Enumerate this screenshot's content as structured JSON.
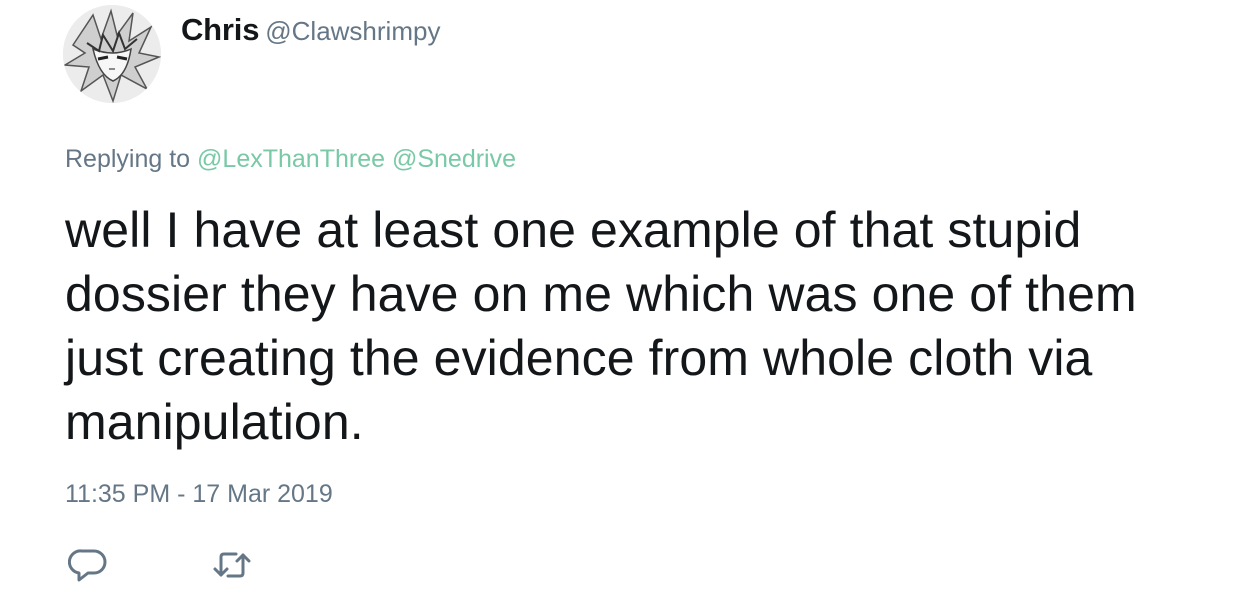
{
  "user": {
    "display_name": "Chris",
    "handle": "@Clawshrimpy",
    "avatar_icon": "anime-avatar-icon"
  },
  "reply_context": {
    "prefix": "Replying to",
    "mentions": [
      "@LexThanThree",
      "@Snedrive"
    ]
  },
  "tweet": {
    "text": "well I have at least one example of that stupid dossier they have on me which was one of them just creating the evidence from whole cloth via manipulation.",
    "timestamp": "11:35 PM - 17 Mar 2019"
  },
  "actions": {
    "reply_icon": "reply-icon",
    "retweet_icon": "retweet-icon"
  },
  "colors": {
    "text": "#14171a",
    "muted": "#657786",
    "mention": "#79c9a7"
  }
}
